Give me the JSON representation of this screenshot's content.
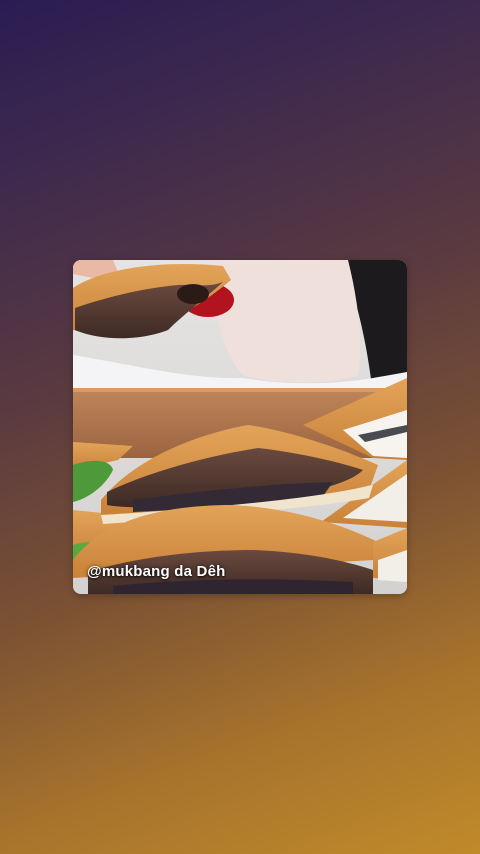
{
  "post": {
    "watermark": "@mukbang da Dêh"
  }
}
